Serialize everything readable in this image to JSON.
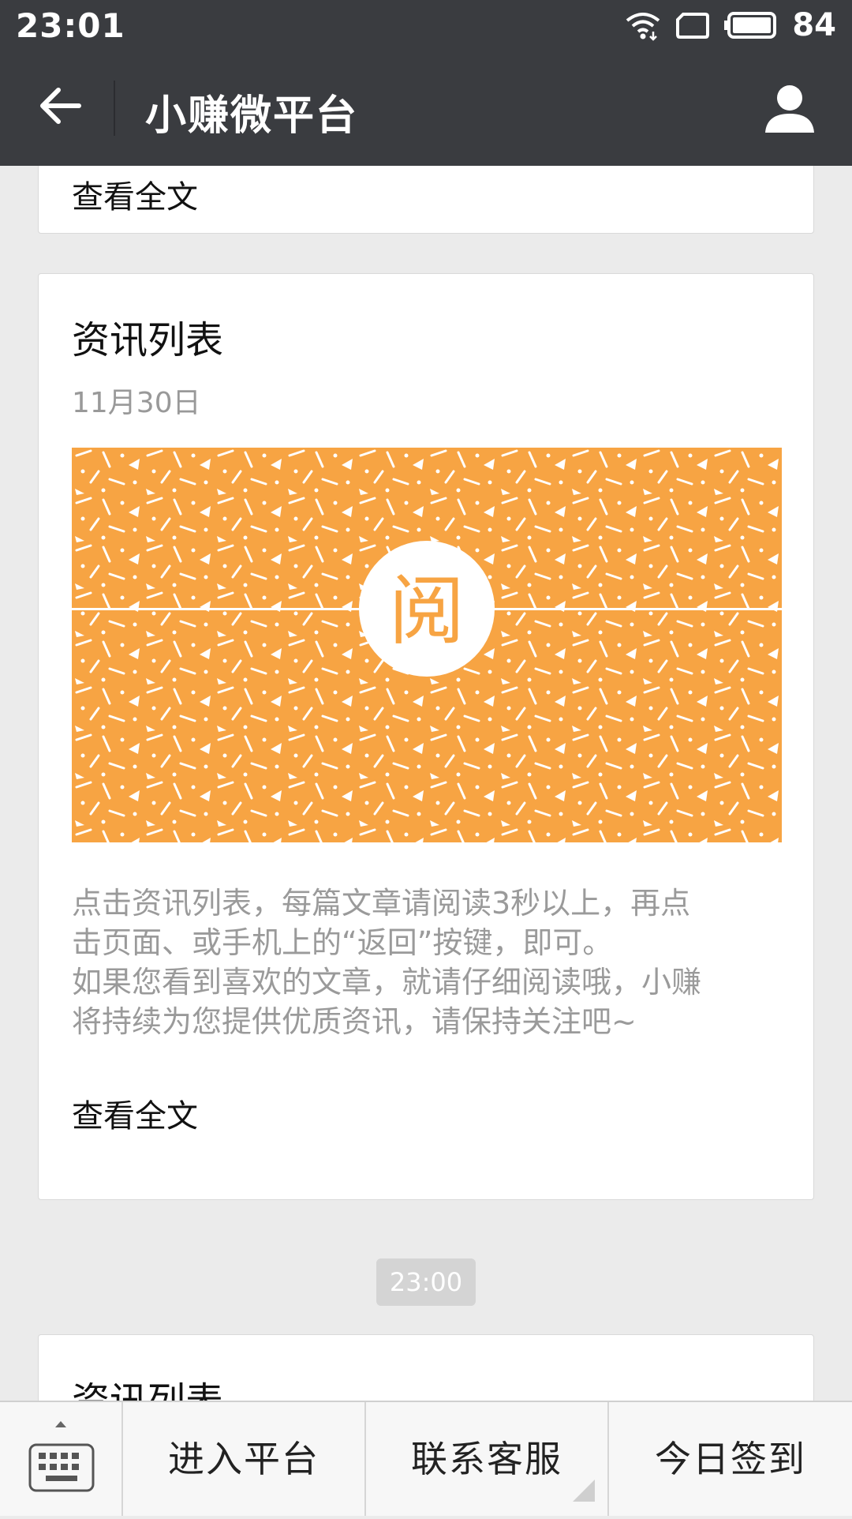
{
  "status_bar": {
    "time": "23:01",
    "battery": "84",
    "icons": [
      "wifi-icon",
      "screen-rotate-icon",
      "battery-icon"
    ]
  },
  "header": {
    "title": "小赚微平台",
    "back_icon": "arrow-left-icon",
    "profile_icon": "person-icon"
  },
  "feed": {
    "previous_card": {
      "read_more": "查看全文"
    },
    "article": {
      "title": "资讯列表",
      "date": "11月30日",
      "banner_char": "阅",
      "description_lines": [
        "点击资讯列表，每篇文章请阅读3秒以上，再点",
        "击页面、或手机上的“返回”按键，即可。",
        "如果您看到喜欢的文章，就请仔细阅读哦，小赚",
        "将持续为您提供优质资讯，请保持关注吧~"
      ],
      "read_more": "查看全文"
    },
    "timestamp": "23:00",
    "next_card": {
      "title": "资讯列表"
    }
  },
  "bottom_menu": {
    "keyboard_icon": "keyboard-icon",
    "items": [
      "进入平台",
      "联系客服",
      "今日签到"
    ]
  },
  "colors": {
    "header_bg": "#3a3c40",
    "banner_orange": "#f7a443",
    "page_bg": "#ebebeb"
  }
}
